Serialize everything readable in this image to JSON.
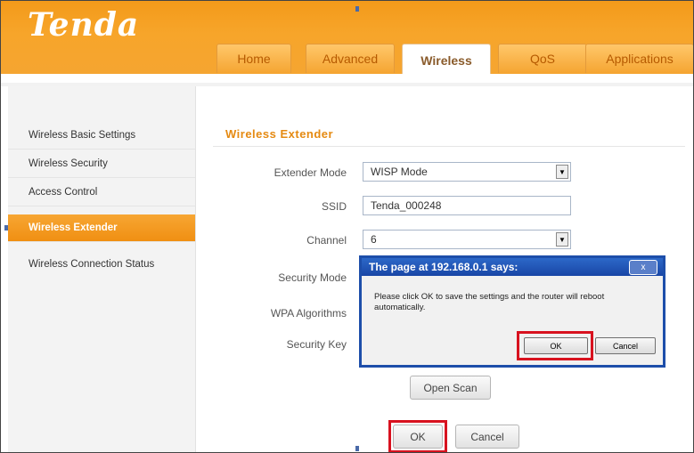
{
  "header": {
    "logo": "Tenda",
    "tabs": [
      {
        "label": "Home"
      },
      {
        "label": "Advanced"
      },
      {
        "label": "Wireless"
      },
      {
        "label": "QoS"
      },
      {
        "label": "Applications"
      }
    ],
    "active_tab": "Wireless"
  },
  "sidebar": {
    "items": [
      {
        "label": "Wireless Basic Settings"
      },
      {
        "label": "Wireless Security"
      },
      {
        "label": "Access Control"
      },
      {
        "label": "Wireless Extender"
      },
      {
        "label": "Wireless Connection Status"
      }
    ],
    "active_item": "Wireless Extender"
  },
  "main": {
    "title": "Wireless Extender",
    "extender_mode": {
      "label": "Extender Mode",
      "value": "WISP Mode"
    },
    "ssid": {
      "label": "SSID",
      "value": "Tenda_000248"
    },
    "channel": {
      "label": "Channel",
      "value": "6"
    },
    "security_mode": {
      "label": "Security Mode"
    },
    "wpa_algorithms": {
      "label": "WPA Algorithms"
    },
    "security_key": {
      "label": "Security Key"
    },
    "open_scan_label": "Open Scan",
    "ok_label": "OK",
    "cancel_label": "Cancel"
  },
  "dialog": {
    "title": "The page at 192.168.0.1 says:",
    "close_label": "x",
    "message": "Please click OK to save the settings and the router will reboot automatically.",
    "ok_label": "OK",
    "cancel_label": "Cancel"
  },
  "colors": {
    "brand_orange": "#f5a531",
    "highlight_red": "#d8121f",
    "dialog_blue": "#1d4eaa"
  }
}
